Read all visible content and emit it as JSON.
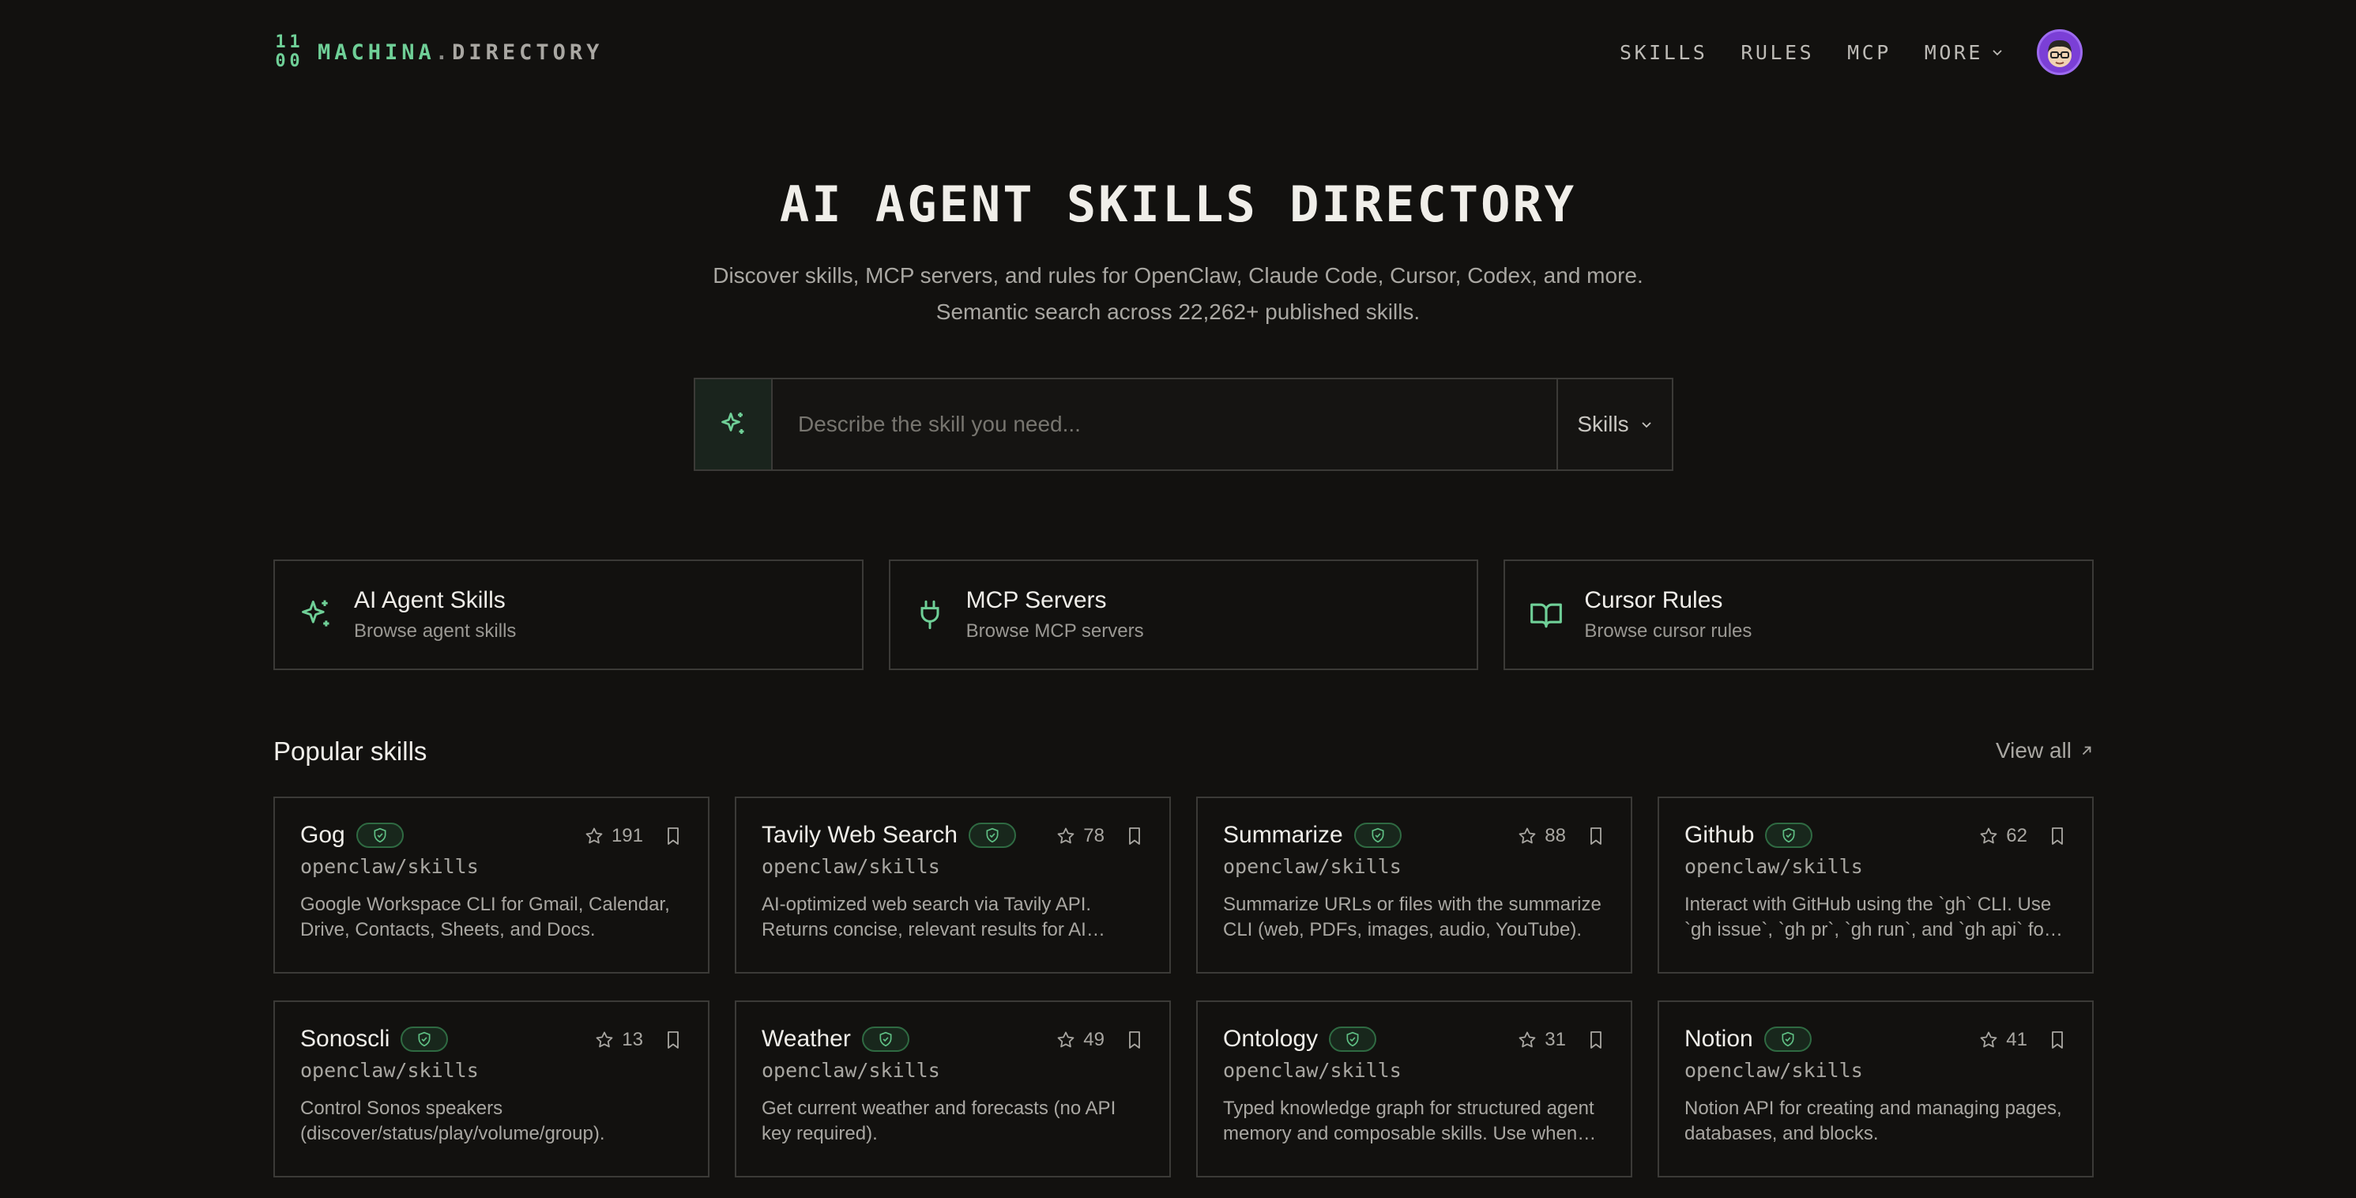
{
  "header": {
    "logo_bits": [
      "1",
      "1",
      "0",
      "0"
    ],
    "logo_brand": "MACHINA",
    "logo_dot": ".",
    "logo_suffix": "DIRECTORY",
    "nav": [
      "SKILLS",
      "RULES",
      "MCP",
      "MORE"
    ]
  },
  "hero": {
    "title": "AI AGENT SKILLS DIRECTORY",
    "subtitle_line1": "Discover skills, MCP servers, and rules for OpenClaw, Claude Code, Cursor, Codex, and more.",
    "subtitle_line2": "Semantic search across 22,262+ published skills."
  },
  "search": {
    "placeholder": "Describe the skill you need...",
    "scope": "Skills"
  },
  "categories": [
    {
      "title": "AI Agent Skills",
      "desc": "Browse agent skills",
      "icon": "sparkles-icon"
    },
    {
      "title": "MCP Servers",
      "desc": "Browse MCP servers",
      "icon": "plug-icon"
    },
    {
      "title": "Cursor Rules",
      "desc": "Browse cursor rules",
      "icon": "book-open-icon"
    }
  ],
  "popular": {
    "title": "Popular skills",
    "view_all": "View all",
    "cards": [
      {
        "name": "Gog",
        "stars": "191",
        "repo": "openclaw/skills",
        "desc": "Google Workspace CLI for Gmail, Calendar, Drive, Contacts, Sheets, and Docs."
      },
      {
        "name": "Tavily Web Search",
        "stars": "78",
        "repo": "openclaw/skills",
        "desc": "AI-optimized web search via Tavily API. Returns concise, relevant results for AI agents."
      },
      {
        "name": "Summarize",
        "stars": "88",
        "repo": "openclaw/skills",
        "desc": "Summarize URLs or files with the summarize CLI (web, PDFs, images, audio, YouTube)."
      },
      {
        "name": "Github",
        "stars": "62",
        "repo": "openclaw/skills",
        "desc": "Interact with GitHub using the `gh` CLI. Use `gh issue`, `gh pr`, `gh run`, and `gh api` for issues."
      },
      {
        "name": "Sonoscli",
        "stars": "13",
        "repo": "openclaw/skills",
        "desc": "Control Sonos speakers (discover/status/play/volume/group)."
      },
      {
        "name": "Weather",
        "stars": "49",
        "repo": "openclaw/skills",
        "desc": "Get current weather and forecasts (no API key required)."
      },
      {
        "name": "Ontology",
        "stars": "31",
        "repo": "openclaw/skills",
        "desc": "Typed knowledge graph for structured agent memory and composable skills. Use when creating entities."
      },
      {
        "name": "Notion",
        "stars": "41",
        "repo": "openclaw/skills",
        "desc": "Notion API for creating and managing pages, databases, and blocks."
      }
    ]
  },
  "colors": {
    "background": "#12110f",
    "accent": "#6fcf97",
    "border": "#3b3a37",
    "avatar": "#7b3fd6"
  }
}
